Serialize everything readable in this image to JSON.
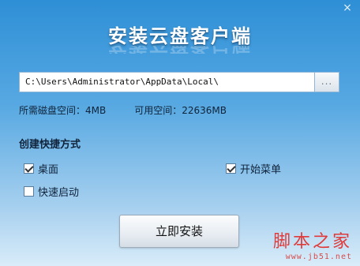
{
  "app": {
    "title": "安装云盘客户端",
    "close_glyph": "×"
  },
  "install_path": {
    "value": "C:\\Users\\Administrator\\AppData\\Local\\",
    "browse_label": "..."
  },
  "space": {
    "required_label": "所需磁盘空间：4MB",
    "available_label": "可用空间：22636MB"
  },
  "shortcuts": {
    "heading": "创建快捷方式",
    "desktop": {
      "label": "桌面",
      "checked": true
    },
    "start_menu": {
      "label": "开始菜单",
      "checked": true
    },
    "quick_launch": {
      "label": "快速启动",
      "checked": false
    }
  },
  "actions": {
    "install_label": "立即安装"
  },
  "watermark": {
    "main": "脚本之家",
    "sub": "www.jb51.net"
  },
  "colors": {
    "background_top": "#2e8fd6",
    "background_bottom": "#d9ecf9",
    "watermark": "#e03a3a"
  }
}
